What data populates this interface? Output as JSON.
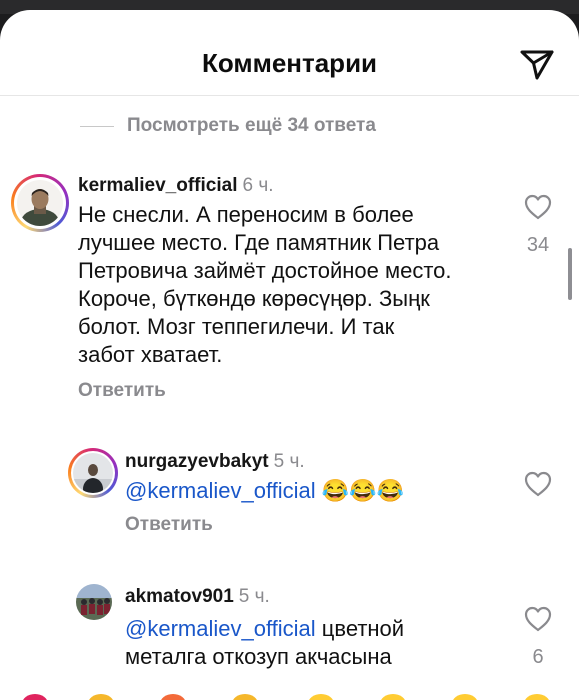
{
  "header": {
    "title": "Комментарии",
    "send_icon": "paper-plane-icon"
  },
  "view_more_replies": "Посмотреть ещё 34 ответа",
  "comments": [
    {
      "username": "kermaliev_official",
      "time": "6 ч.",
      "lines": [
        "Не снесли. А переносим в более",
        "лучшее место. Где памятник Петра",
        "Петровича займёт достойное место.",
        "Короче, бүткөндө көрөсүңөр. Зыңк",
        "болот. Мозг теппегилечи. И так",
        "забот хватает."
      ],
      "reply_label": "Ответить",
      "likes": "34"
    },
    {
      "username": "nurgazyevbakyt",
      "time": "5 ч.",
      "mention": "@kermaliev_official",
      "emojis": "😂😂😂",
      "reply_label": "Ответить"
    },
    {
      "username": "akmatov901",
      "time": "5 ч.",
      "mention": "@kermaliev_official",
      "text_after_mention": " цветной",
      "line2": "металга откозуп акчасына",
      "likes": "6"
    }
  ],
  "colors": {
    "mention": "#1a57c9",
    "secondary_text": "#8a8a8e",
    "background": "#ffffff"
  }
}
